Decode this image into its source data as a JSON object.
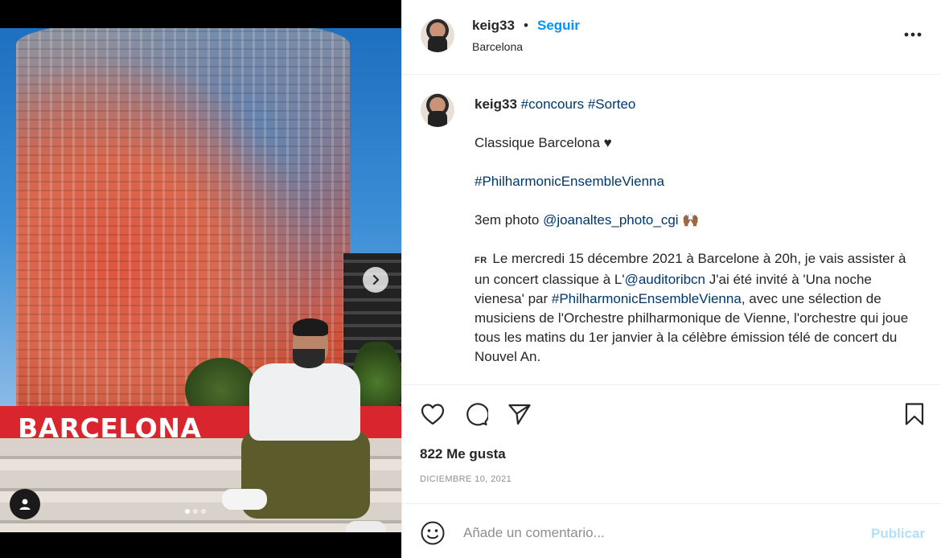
{
  "post": {
    "username": "keig33",
    "separator": "•",
    "follow_label": "Seguir",
    "location": "Barcelona",
    "photo_sign_text": "BARCELONA",
    "carousel": {
      "current": 1,
      "total": 3
    }
  },
  "caption": {
    "username": "keig33",
    "hashtags_line": "#concours #Sorteo",
    "line1": "Classique Barcelona ♥",
    "hashtag_main": "#PhilharmonicEnsembleVienna",
    "photo_credit_prefix": "3em photo ",
    "photo_credit_mention": "@joanaltes_photo_cgi",
    "photo_credit_emoji": "🙌🏾",
    "lang_flag": "FR",
    "para_part1": " Le mercredi 15 décembre 2021 à Barcelone à 20h, je vais assister à un concert classique à L'",
    "para_mention": "@auditoribcn",
    "para_part2": " J'ai été invité à 'Una noche vienesa' par ",
    "para_hashtag": "#PhilharmonicEnsembleVienna",
    "para_part3": ", avec une sélection de musiciens de l'Orchestre philharmonique de Vienne, l'orchestre qui joue tous les matins du 1er janvier à la célèbre émission télé de concert du Nouvel An."
  },
  "actions": {
    "icons": [
      "heart-icon",
      "comment-icon",
      "share-icon",
      "bookmark-icon"
    ],
    "likes": "822 Me gusta",
    "date": "DICIEMBRE 10, 2021"
  },
  "comment_box": {
    "placeholder": "Añade un comentario...",
    "publish_label": "Publicar",
    "publish_color": "#b2dffc"
  },
  "colors": {
    "link": "#00376b",
    "follow": "#0095f6",
    "muted": "#8e8e8e"
  }
}
